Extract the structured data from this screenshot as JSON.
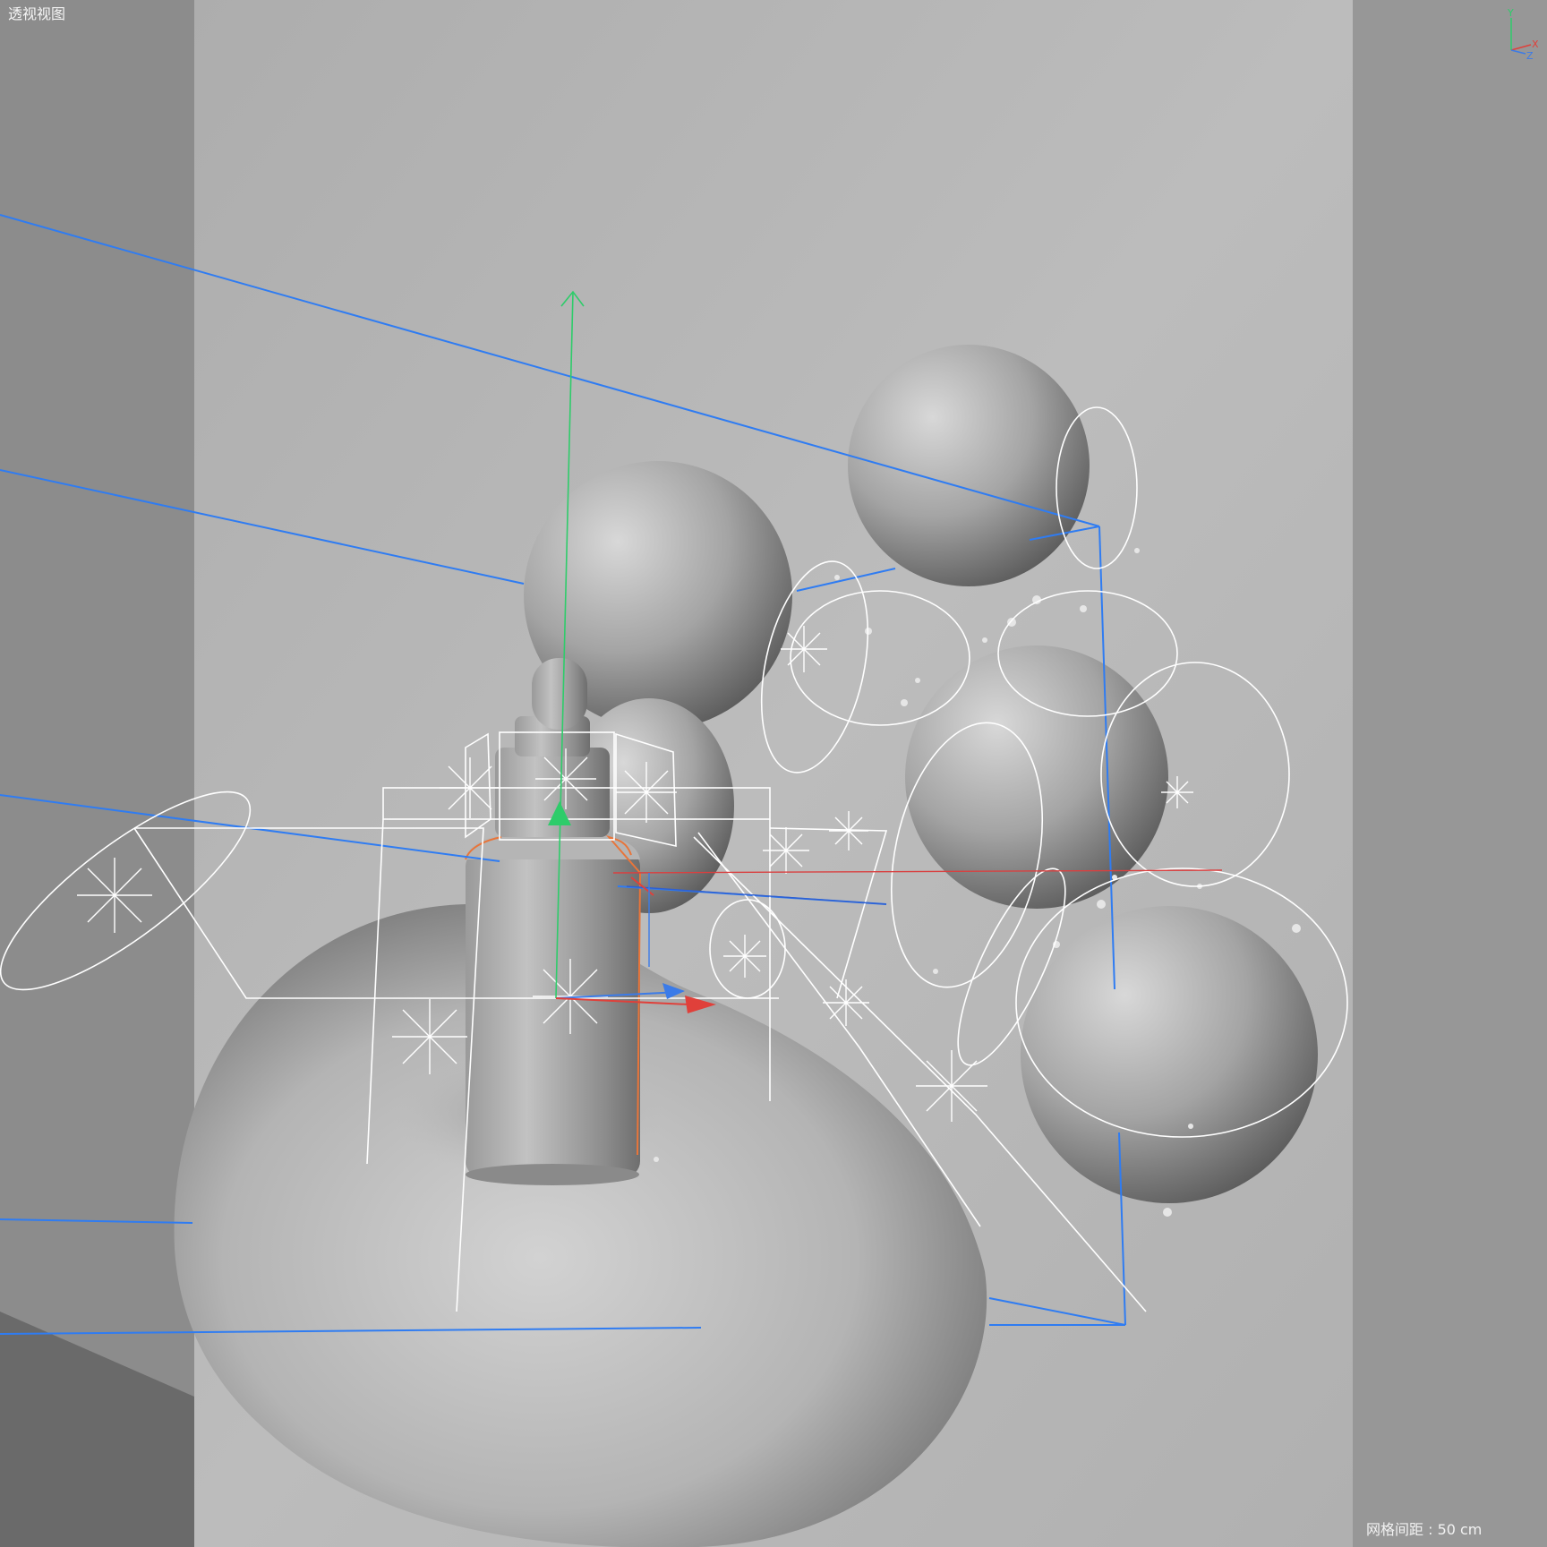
{
  "viewport": {
    "view_label": "透视视图",
    "grid_spacing_label": "网格间距 : 50 cm"
  },
  "axis_gizmo": {
    "y_label": "Y",
    "x_label": "X",
    "z_label": "Z",
    "colors": {
      "x": "#e0403a",
      "y": "#2ecc6a",
      "z": "#3b7be8"
    }
  },
  "scene": {
    "object_icons": [
      "sphere",
      "dropper-bottle",
      "metaball-blob",
      "light-star",
      "camera-frame",
      "move-gizmo"
    ],
    "colors": {
      "frame_lines": "#2f7cf2",
      "wireframe": "#ffffff",
      "selection_outline": "#e8753a",
      "side_panels": "#8e8e8e",
      "backdrop": "#b5b5b5"
    }
  }
}
